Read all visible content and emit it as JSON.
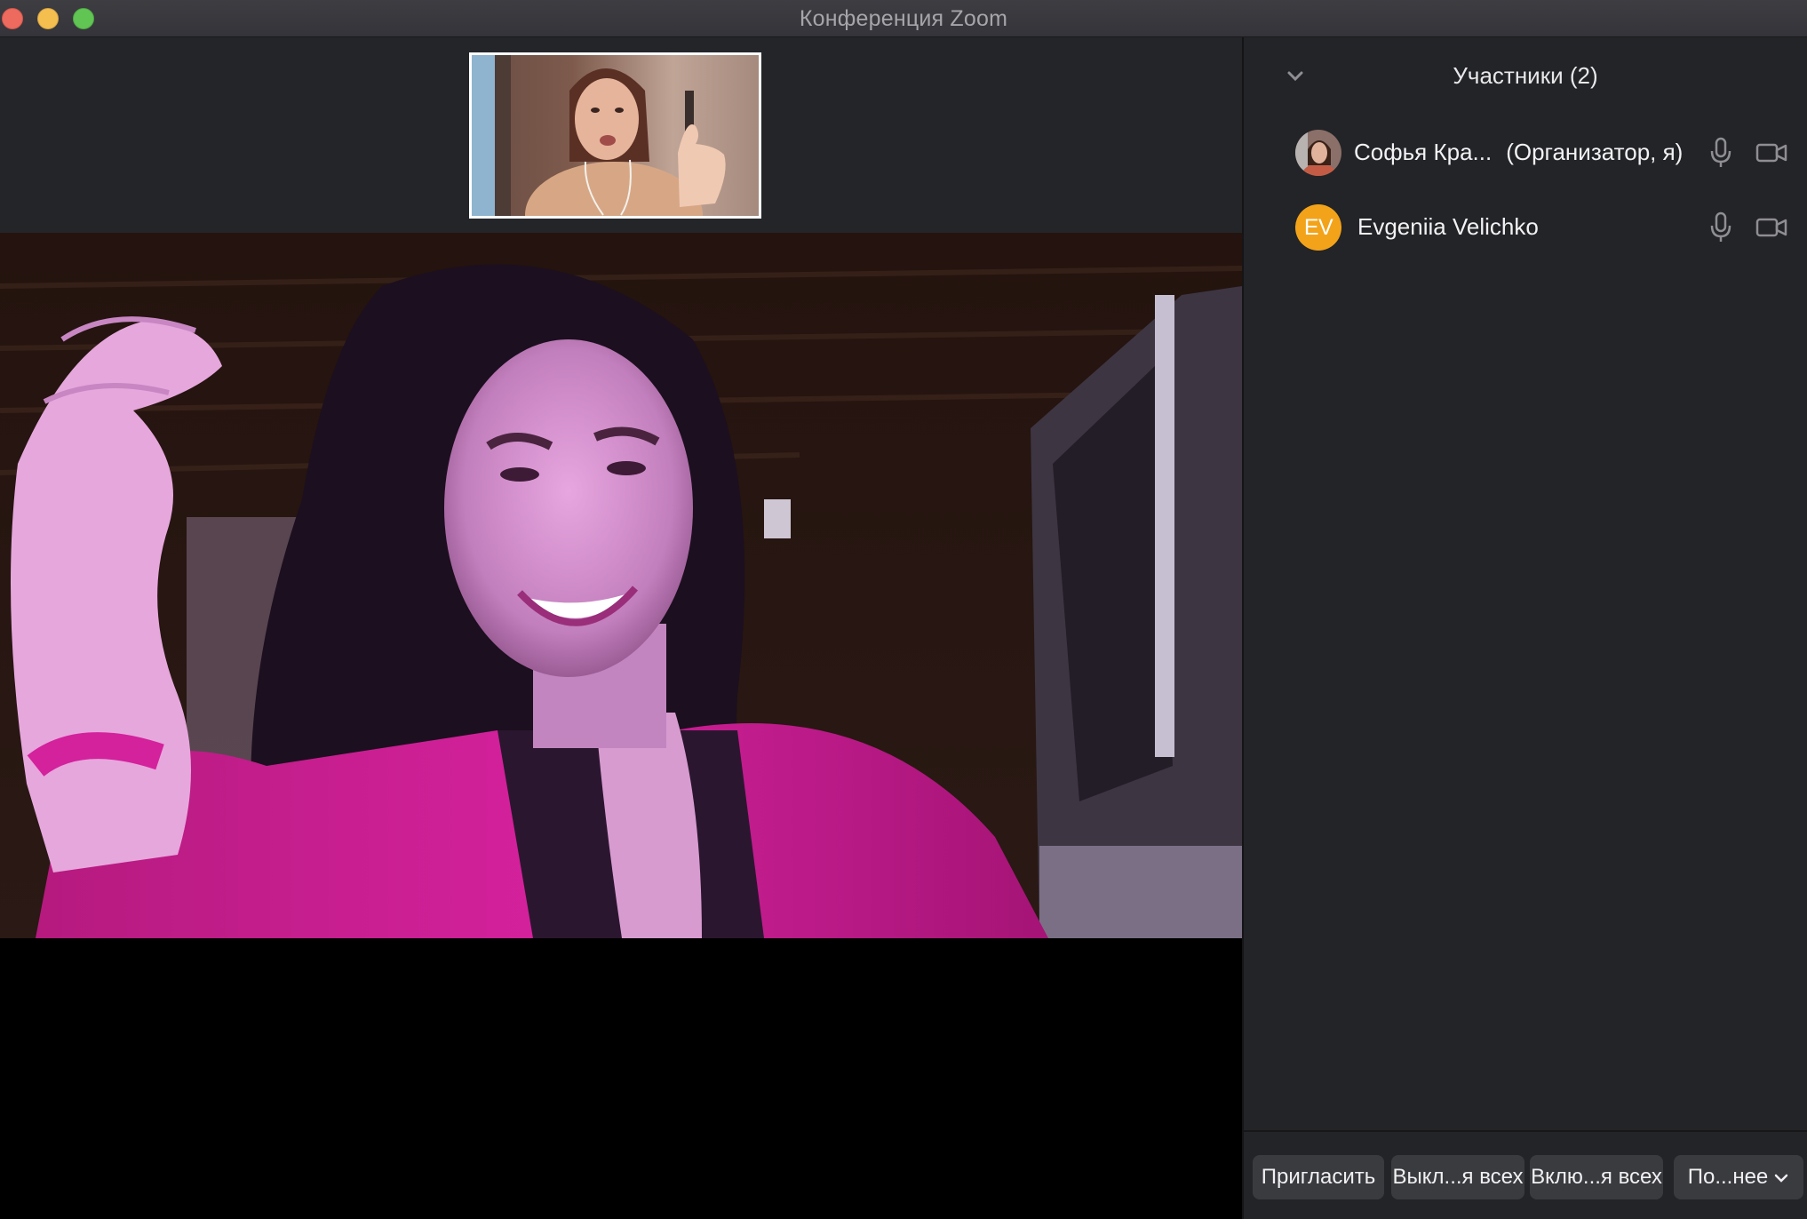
{
  "window": {
    "title": "Конференция Zoom",
    "controls": [
      "close",
      "minimize",
      "maximize"
    ]
  },
  "video": {
    "thumbnail_label": "",
    "active_speaker_label": ""
  },
  "participants_panel": {
    "title": "Участники (2)",
    "participants": [
      {
        "name": "Софья Кра...",
        "role": "(Организатор, я)",
        "avatar": "photo",
        "mic_icon": "microphone-icon",
        "video_icon": "video-camera-icon"
      },
      {
        "name": "Evgeniia Velichko",
        "role": "",
        "avatar_initials": "EV",
        "avatar_color": "#f3a31a",
        "mic_icon": "microphone-icon",
        "video_icon": "video-camera-icon"
      }
    ],
    "buttons": {
      "invite": "Пригласить",
      "mute_all": "Выкл...я всех",
      "unmute_all": "Вклю...я всех",
      "more": "По...нее"
    }
  },
  "colors": {
    "panel_bg": "#232427",
    "button_bg": "#3a3b3f",
    "avatar_ev": "#f3a31a",
    "thumb_border": "#ffffff"
  }
}
